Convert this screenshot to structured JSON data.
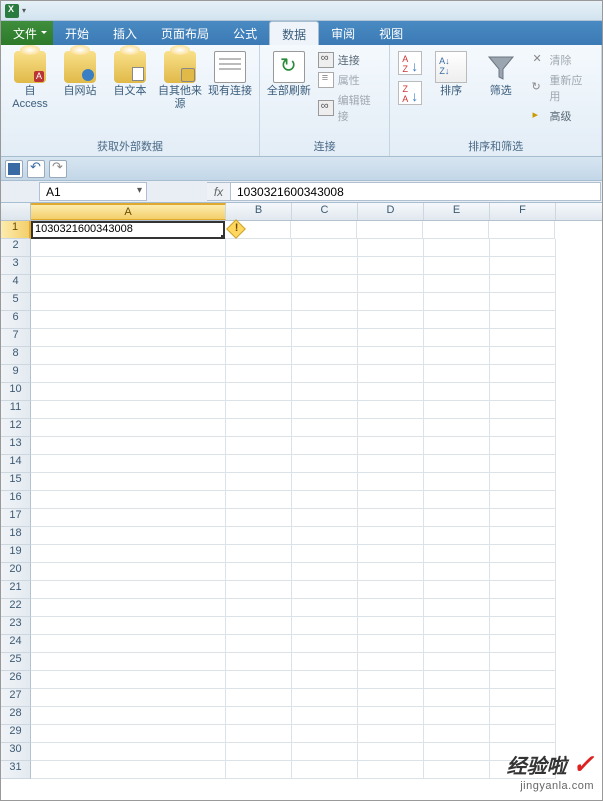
{
  "tabs": {
    "file": "文件",
    "home": "开始",
    "insert": "插入",
    "layout": "页面布局",
    "formula": "公式",
    "data": "数据",
    "review": "审阅",
    "view": "视图",
    "active": "data"
  },
  "ribbon": {
    "ext_data": {
      "access": "自 Access",
      "web": "自网站",
      "text": "自文本",
      "other": "自其他来源",
      "existing": "现有连接",
      "title": "获取外部数据"
    },
    "conn": {
      "refresh": "全部刷新",
      "connections": "连接",
      "properties": "属性",
      "editlinks": "编辑链接",
      "title": "连接"
    },
    "sort": {
      "sortbtn": "排序",
      "filter": "筛选",
      "clear": "清除",
      "reapply": "重新应用",
      "advanced": "高级",
      "title": "排序和筛选"
    }
  },
  "fbar": {
    "name": "A1",
    "fx": "fx",
    "value": "1030321600343008"
  },
  "columns": [
    "A",
    "B",
    "C",
    "D",
    "E",
    "F"
  ],
  "rows": [
    "1",
    "2",
    "3",
    "4",
    "5",
    "6",
    "7",
    "8",
    "9",
    "10",
    "11",
    "12",
    "13",
    "14",
    "15",
    "16",
    "17",
    "18",
    "19",
    "20",
    "21",
    "22",
    "23",
    "24",
    "25",
    "26",
    "27",
    "28",
    "29",
    "30",
    "31"
  ],
  "cellA1": "1030321600343008",
  "watermark": {
    "line1": "经验啦",
    "check": "✓",
    "line2": "jingyanla.com"
  },
  "chart_data": {
    "type": "table",
    "columns": [
      "A",
      "B",
      "C",
      "D",
      "E",
      "F"
    ],
    "data": [
      [
        "1030321600343008",
        "",
        "",
        "",
        "",
        ""
      ]
    ],
    "selected_cell": "A1",
    "formula_bar": "1030321600343008"
  }
}
